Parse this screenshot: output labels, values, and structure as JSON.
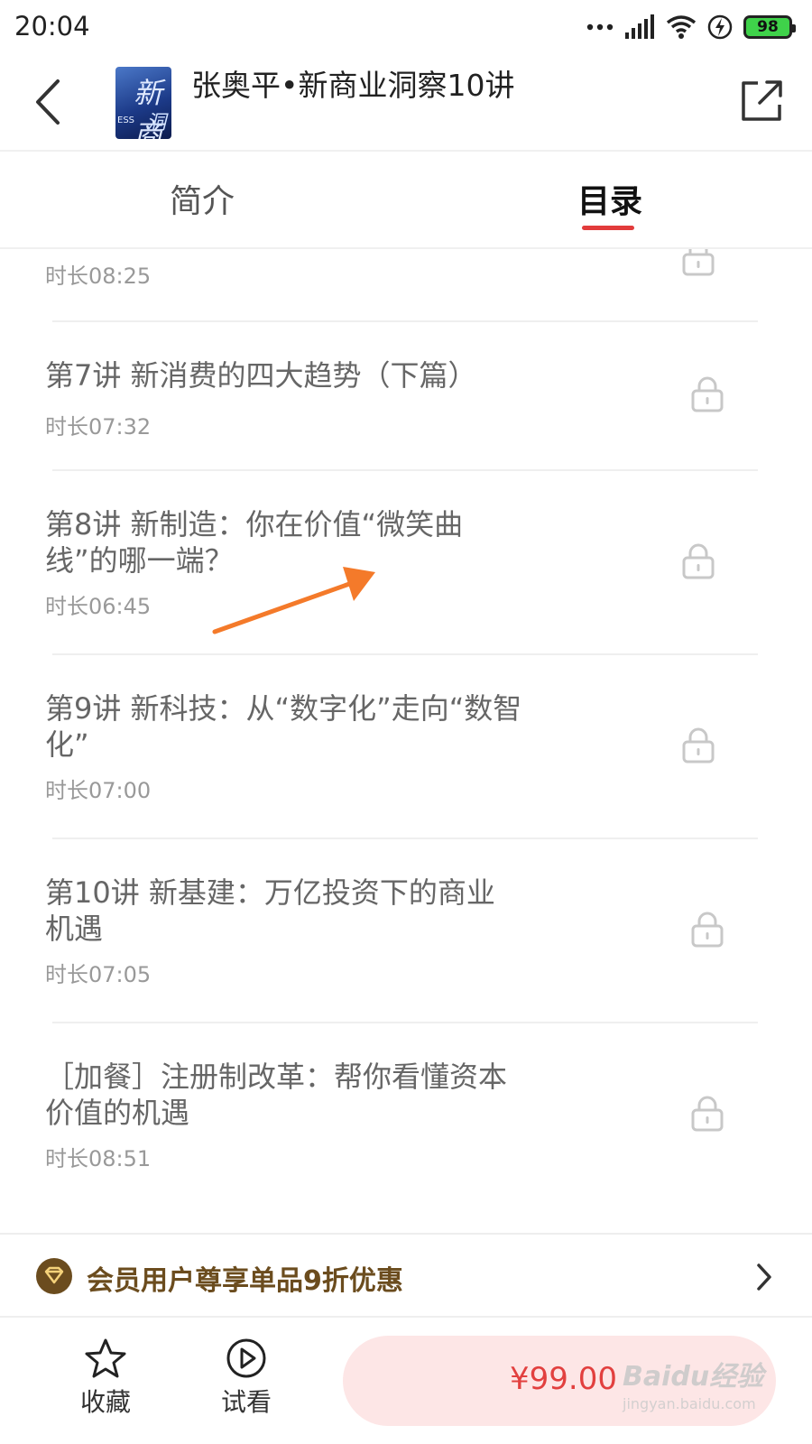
{
  "status_bar": {
    "time": "20:04",
    "battery": "98",
    "icons": [
      "more-dots-icon",
      "signal-icon",
      "wifi-icon",
      "charging-icon",
      "battery-icon"
    ]
  },
  "header": {
    "title": "张奥平•新商业洞察10讲",
    "cover_text": [
      "新商",
      "洞察",
      "ESS"
    ]
  },
  "tabs": [
    {
      "label": "简介",
      "active": false
    },
    {
      "label": "目录",
      "active": true
    }
  ],
  "lessons": [
    {
      "title_lines": [],
      "duration": "时长08:25",
      "locked": true
    },
    {
      "title_lines": [
        "第7讲 新消费的四大趋势（下篇）"
      ],
      "duration": "时长07:32",
      "locked": true
    },
    {
      "title_lines": [
        "第8讲 新制造：你在价值“微笑曲",
        "线”的哪一端？"
      ],
      "duration": "时长06:45",
      "locked": true
    },
    {
      "title_lines": [
        "第9讲 新科技：从“数字化”走向“数智",
        "化”"
      ],
      "duration": "时长07:00",
      "locked": true
    },
    {
      "title_lines": [
        "第10讲 新基建：万亿投资下的商业",
        "机遇"
      ],
      "duration": "时长07:05",
      "locked": true
    },
    {
      "title_lines": [
        "［加餐］注册制改革：帮你看懂资本",
        "价值的机遇"
      ],
      "duration": "时长08:51",
      "locked": true
    }
  ],
  "member_banner": {
    "text": "会员用户尊享单品9折优惠"
  },
  "bottom_bar": {
    "favorite_label": "收藏",
    "trial_label": "试看",
    "price": "¥99.00"
  },
  "watermark": {
    "main": "Baidu经验",
    "sub": "jingyan.baidu.com"
  },
  "colors": {
    "accent_red": "#e23b3b",
    "price_red": "#e2403f",
    "buy_bg": "#fde6e6",
    "member_brown": "#6b4c1e",
    "annotation_orange": "#f47a2a"
  }
}
